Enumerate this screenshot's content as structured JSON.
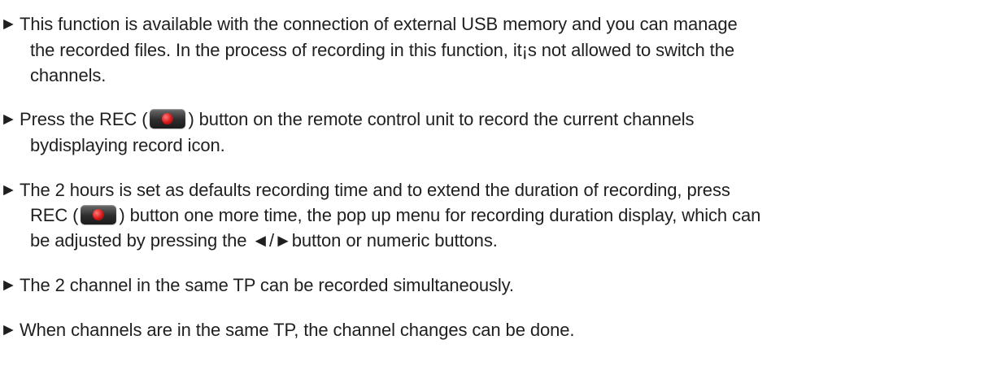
{
  "bullets": [
    {
      "marker": "►",
      "lines": [
        "This function is available with the connection of external USB memory and you can manage",
        "the recorded files. In the process of recording in this function, it¡s not allowed to switch the",
        "channels."
      ]
    },
    {
      "marker": "►",
      "parts": {
        "before": "Press the REC (",
        "after": ") button on the remote control unit to record the current channels"
      },
      "lines": [
        "bydisplaying record icon."
      ]
    },
    {
      "marker": "►",
      "lines": [
        "The 2 hours is set as defaults recording time and to extend the duration of recording, press",
        "be adjusted  by pressing the ◄/►button or numeric buttons."
      ],
      "parts": {
        "before": "REC (",
        "after": ") button one more time,  the pop up menu for recording duration display, which can"
      }
    },
    {
      "marker": "►",
      "lines": [
        "The 2 channel in the same TP can be recorded simultaneously."
      ]
    },
    {
      "marker": "►",
      "lines": [
        "When channels are in the same TP, the channel changes can be done."
      ]
    }
  ],
  "icons": {
    "rec_button": "record-button-icon",
    "rec_color": "#d61616"
  }
}
